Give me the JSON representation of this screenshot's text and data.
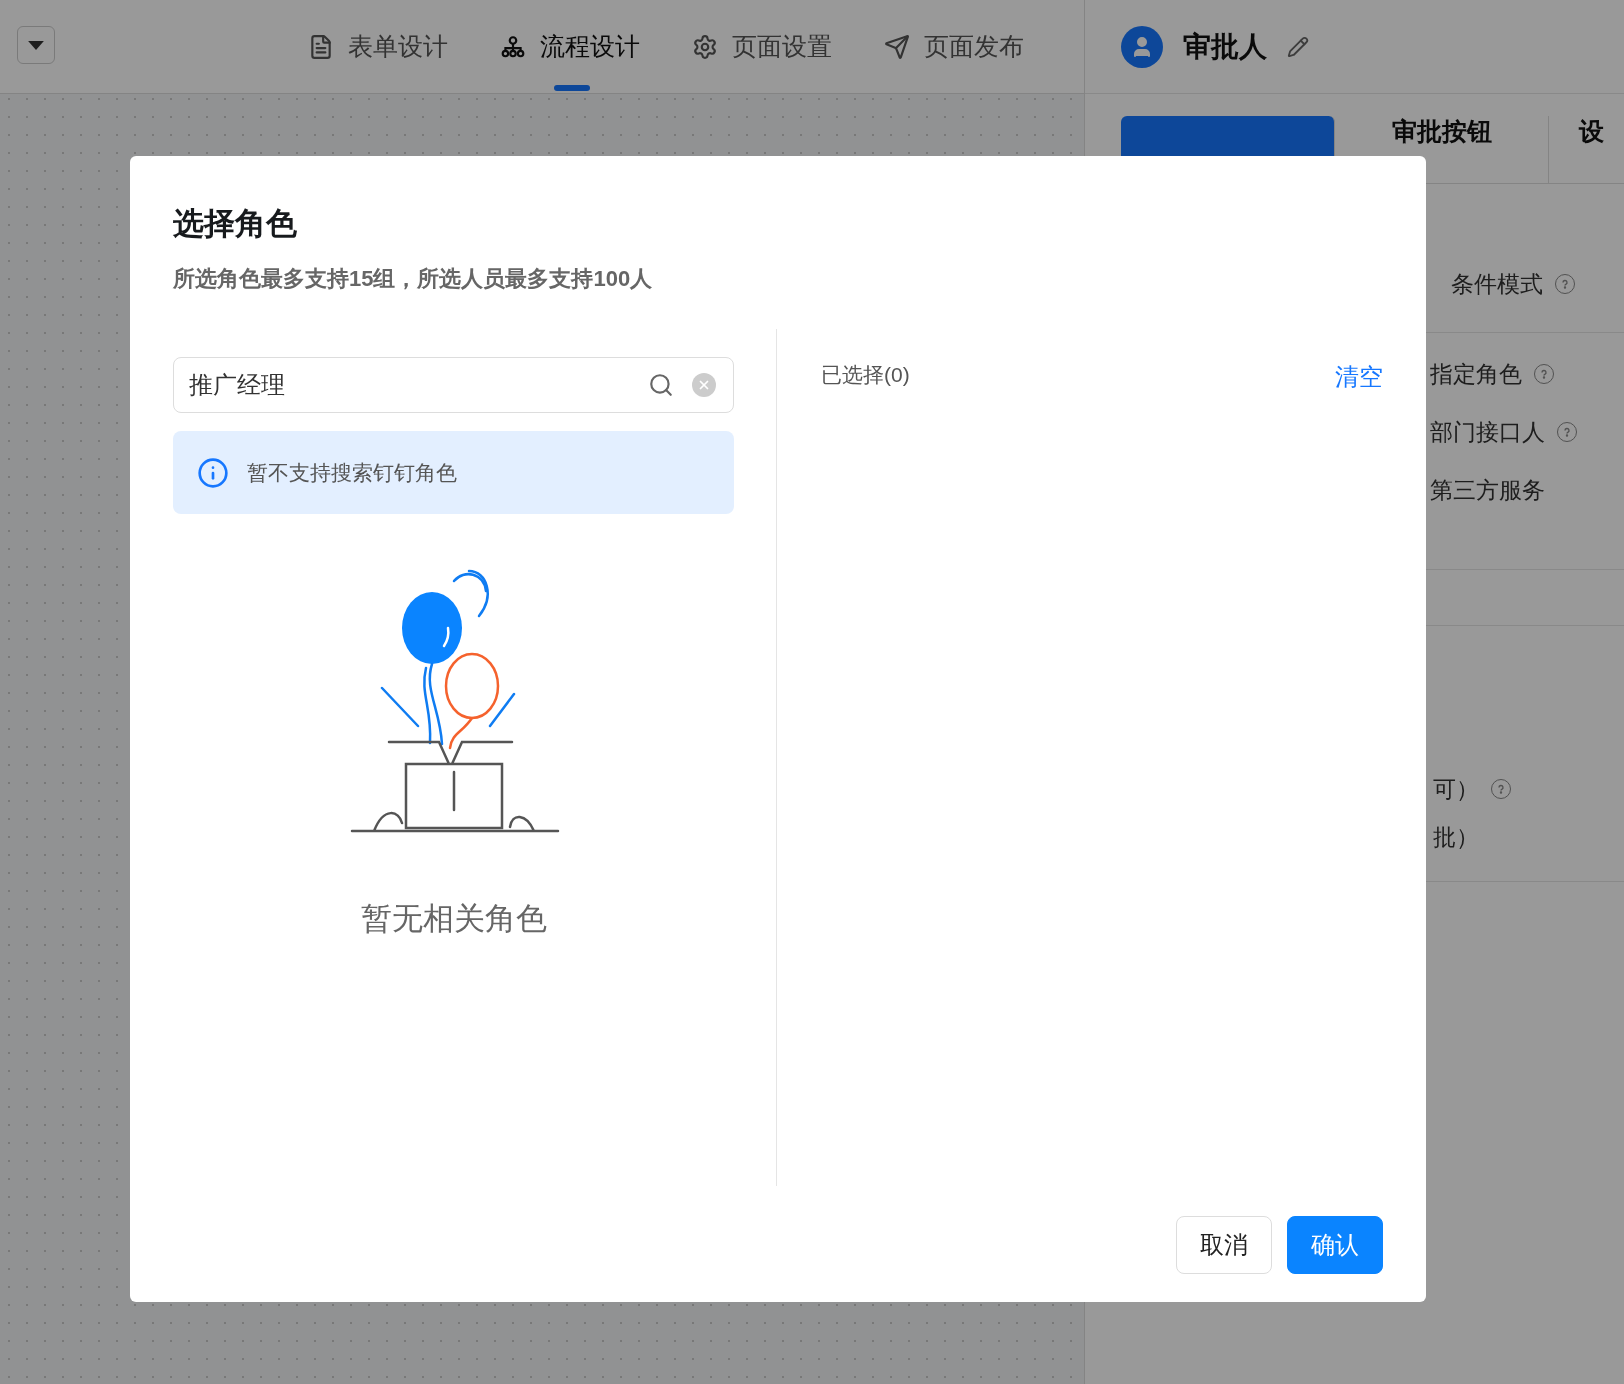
{
  "top_bar": {
    "tabs": [
      {
        "label": "表单设计",
        "selected": false
      },
      {
        "label": "流程设计",
        "selected": true
      },
      {
        "label": "页面设置",
        "selected": false
      },
      {
        "label": "页面发布",
        "selected": false
      }
    ]
  },
  "side_panel": {
    "title": "审批人",
    "tabs": [
      {
        "selected": true
      },
      {
        "label": "审批按钮",
        "selected": false
      },
      {
        "label": "设",
        "selected": false
      }
    ],
    "options": [
      {
        "label": "条件模式",
        "help": true
      },
      {
        "label": "指定角色",
        "help": true
      },
      {
        "label": "部门接口人",
        "help": true
      },
      {
        "label": "第三方服务",
        "help": false
      }
    ],
    "partial_options": [
      {
        "label": "可）",
        "help": true
      },
      {
        "label": "批）",
        "help": false
      }
    ]
  },
  "dialog": {
    "title": "选择角色",
    "subtitle": "所选角色最多支持15组，所选人员最多支持100人",
    "search": {
      "value": "推广经理"
    },
    "notice": "暂不支持搜索钉钉角色",
    "empty_text": "暂无相关角色",
    "selected_label": "已选择(0)",
    "clear_link": "清空",
    "buttons": [
      {
        "label": "取消",
        "kind": "secondary"
      },
      {
        "label": "确认",
        "kind": "primary"
      }
    ]
  }
}
